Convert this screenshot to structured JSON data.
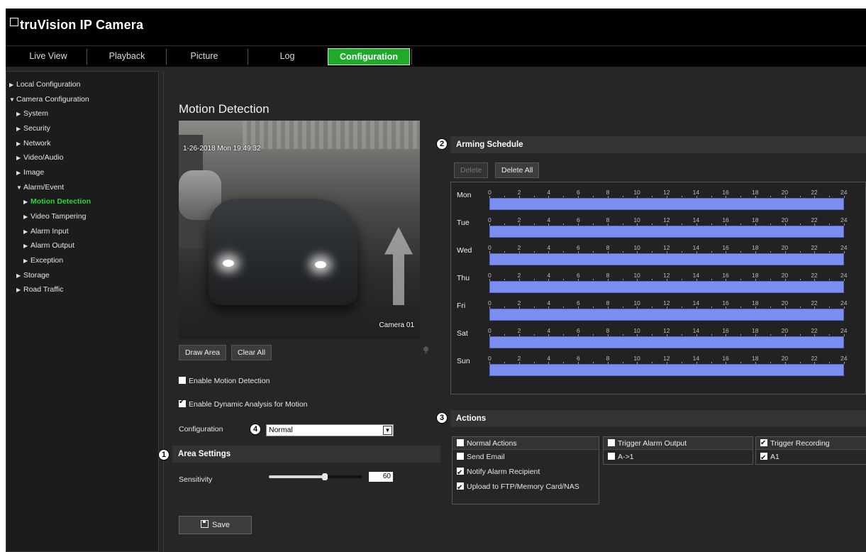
{
  "app": {
    "brand": "truVision IP Camera"
  },
  "nav": {
    "tabs": [
      "Live View",
      "Playback",
      "Picture",
      "Log",
      "Configuration"
    ],
    "active": "Configuration"
  },
  "sidebar": {
    "items": [
      {
        "label": "Local Configuration",
        "caret": "▶"
      },
      {
        "label": "Camera Configuration",
        "caret": "▼"
      },
      {
        "label": "System",
        "caret": "▶"
      },
      {
        "label": "Security",
        "caret": "▶"
      },
      {
        "label": "Network",
        "caret": "▶"
      },
      {
        "label": "Video/Audio",
        "caret": "▶"
      },
      {
        "label": "Image",
        "caret": "▶"
      },
      {
        "label": "Alarm/Event",
        "caret": "▼"
      },
      {
        "label": "Motion Detection",
        "caret": "▶"
      },
      {
        "label": "Video Tampering",
        "caret": "▶"
      },
      {
        "label": "Alarm Input",
        "caret": "▶"
      },
      {
        "label": "Alarm Output",
        "caret": "▶"
      },
      {
        "label": "Exception",
        "caret": "▶"
      },
      {
        "label": "Storage",
        "caret": "▶"
      },
      {
        "label": "Road Traffic",
        "caret": "▶"
      }
    ]
  },
  "page": {
    "title": "Motion Detection"
  },
  "video": {
    "timestamp": "1-26-2018 Mon 19:49:32",
    "camera_name": "Camera 01"
  },
  "controls": {
    "draw_area": "Draw Area",
    "clear_all": "Clear All",
    "enable_motion": "Enable Motion Detection",
    "enable_motion_checked": false,
    "enable_dynamic": "Enable Dynamic Analysis for Motion",
    "enable_dynamic_checked": true,
    "configuration_label": "Configuration",
    "configuration_value": "Normal",
    "dropdown_glyph": "▼"
  },
  "badges": [
    "1",
    "2",
    "3",
    "4"
  ],
  "area": {
    "title": "Area Settings",
    "sensitivity_label": "Sensitivity",
    "sensitivity": 60
  },
  "schedule": {
    "title": "Arming Schedule",
    "delete": "Delete",
    "delete_all": "Delete All",
    "days": [
      "Mon",
      "Tue",
      "Wed",
      "Thu",
      "Fri",
      "Sat",
      "Sun"
    ],
    "hours": [
      "0",
      "2",
      "4",
      "6",
      "8",
      "10",
      "12",
      "14",
      "16",
      "18",
      "20",
      "22",
      "24"
    ]
  },
  "actions": {
    "title": "Actions",
    "normal": {
      "header": "Normal Actions",
      "header_checked": false,
      "items": [
        {
          "label": "Send Email",
          "checked": false
        },
        {
          "label": "Notify Alarm Recipient",
          "checked": true
        },
        {
          "label": "Upload to FTP/Memory Card/NAS",
          "checked": true
        }
      ]
    },
    "alarm_output": {
      "header": "Trigger Alarm Output",
      "header_checked": false,
      "items": [
        {
          "label": "A->1",
          "checked": false
        }
      ]
    },
    "recording": {
      "header": "Trigger Recording",
      "header_checked": true,
      "items": [
        {
          "label": "A1",
          "checked": true
        }
      ]
    }
  },
  "save": {
    "label": "Save"
  }
}
